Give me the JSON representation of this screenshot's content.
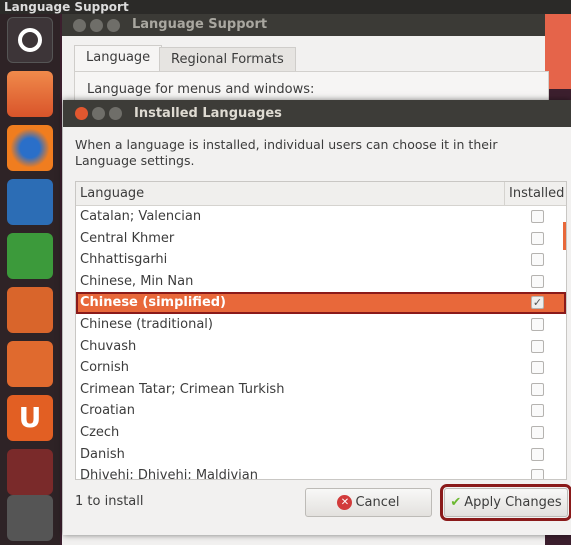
{
  "topbar": {
    "title": "Language Support"
  },
  "launcher": {
    "items": [
      "ubuntu-dash",
      "files",
      "firefox",
      "writer",
      "calc",
      "impress",
      "software-center",
      "ubuntu-one",
      "system-settings",
      "trash"
    ]
  },
  "bg_window": {
    "title": "Language Support",
    "tabs": [
      "Language",
      "Regional Formats"
    ],
    "label": "Language for menus and windows:"
  },
  "dialog": {
    "title": "Installed Languages",
    "description": "When a language is installed, individual users can choose it in their Language settings.",
    "columns": [
      "Language",
      "Installed"
    ],
    "rows": [
      {
        "name": "Catalan; Valencian",
        "installed": false
      },
      {
        "name": "Central Khmer",
        "installed": false
      },
      {
        "name": "Chhattisgarhi",
        "installed": false
      },
      {
        "name": "Chinese, Min Nan",
        "installed": false
      },
      {
        "name": "Chinese (simplified)",
        "installed": true,
        "selected": true
      },
      {
        "name": "Chinese (traditional)",
        "installed": false
      },
      {
        "name": "Chuvash",
        "installed": false
      },
      {
        "name": "Cornish",
        "installed": false
      },
      {
        "name": "Crimean Tatar; Crimean Turkish",
        "installed": false
      },
      {
        "name": "Croatian",
        "installed": false
      },
      {
        "name": "Czech",
        "installed": false
      },
      {
        "name": "Danish",
        "installed": false
      },
      {
        "name": "Dhivehi; Dhivehi; Maldivian",
        "installed": false
      }
    ],
    "status": "1 to install",
    "cancel": "Cancel",
    "apply": "Apply Changes"
  },
  "colors": {
    "selection": "#e8683a",
    "highlight_border": "#8a1a1a"
  }
}
